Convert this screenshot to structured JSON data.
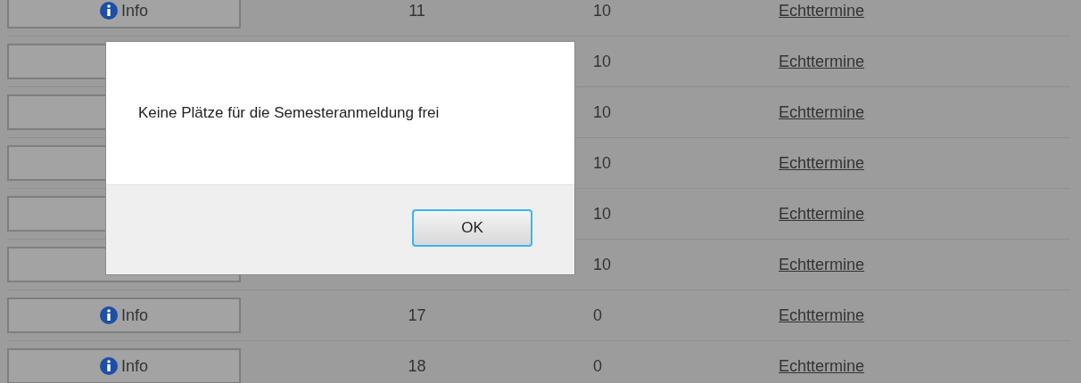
{
  "table": {
    "rows": [
      {
        "info_label": "Info",
        "column_2": "11",
        "column_3": "10",
        "link": "Echttermine"
      },
      {
        "column_3": "10",
        "link": "Echttermine"
      },
      {
        "column_3": "10",
        "link": "Echttermine"
      },
      {
        "column_3": "10",
        "link": "Echttermine"
      },
      {
        "column_3": "10",
        "link": "Echttermine"
      },
      {
        "column_3": "10",
        "link": "Echttermine"
      },
      {
        "info_label": "Info",
        "column_2": "17",
        "column_3": "0",
        "link": "Echttermine"
      },
      {
        "info_label": "Info",
        "column_2": "18",
        "column_3": "0",
        "link": "Echttermine"
      }
    ]
  },
  "dialog": {
    "message": "Keine Plätze für die Semesteranmeldung frei",
    "button": "OK"
  }
}
